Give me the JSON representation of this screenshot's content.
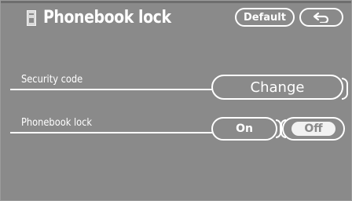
{
  "header": {
    "title": "Phonebook lock",
    "default_label": "Default",
    "back_icon": "back-arrow-icon",
    "title_icon": "phonebook-icon"
  },
  "rows": [
    {
      "label": "Security code",
      "button_label": "Change"
    },
    {
      "label": "Phonebook lock",
      "on_label": "On",
      "off_label": "Off",
      "selected": "Off"
    }
  ],
  "colors": {
    "background": "#8a8a8a",
    "foreground": "#ffffff",
    "selected_fill": "#f2f2f2"
  }
}
